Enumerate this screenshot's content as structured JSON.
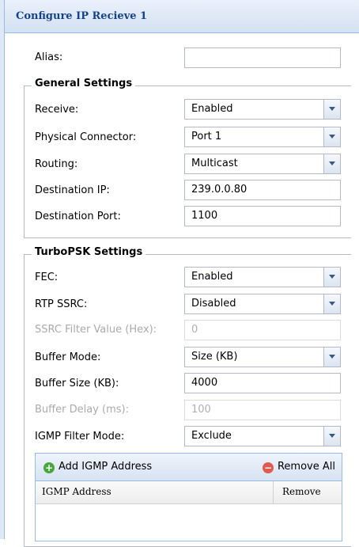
{
  "window": {
    "title": "Configure IP Recieve 1"
  },
  "alias": {
    "label": "Alias:",
    "value": ""
  },
  "general": {
    "legend": "General Settings",
    "receive": {
      "label": "Receive:",
      "value": "Enabled"
    },
    "physical_connector": {
      "label": "Physical Connector:",
      "value": "Port 1"
    },
    "routing": {
      "label": "Routing:",
      "value": "Multicast"
    },
    "destination_ip": {
      "label": "Destination IP:",
      "value": "239.0.0.80"
    },
    "destination_port": {
      "label": "Destination Port:",
      "value": "1100"
    }
  },
  "turbopsk": {
    "legend": "TurboPSK Settings",
    "fec": {
      "label": "FEC:",
      "value": "Enabled"
    },
    "rtp_ssrc": {
      "label": "RTP SSRC:",
      "value": "Disabled"
    },
    "ssrc_filter": {
      "label": "SSRC Filter Value (Hex):",
      "value": "0"
    },
    "buffer_mode": {
      "label": "Buffer Mode:",
      "value": "Size (KB)"
    },
    "buffer_size": {
      "label": "Buffer Size (KB):",
      "value": "4000"
    },
    "buffer_delay": {
      "label": "Buffer Delay (ms):",
      "value": "100"
    },
    "igmp_filter_mode": {
      "label": "IGMP Filter Mode:",
      "value": "Exclude"
    }
  },
  "igmp_grid": {
    "add_label": "Add IGMP Address",
    "remove_all_label": "Remove All",
    "columns": [
      "IGMP Address",
      "Remove"
    ]
  },
  "colors": {
    "title_text": "#15428b",
    "border": "#99bbe8",
    "add_icon": "#4aa63a",
    "remove_icon": "#e05a4f"
  },
  "icons": {
    "add": "plus-circle-icon",
    "remove_all": "minus-circle-icon",
    "dropdown": "chevron-down-icon"
  }
}
